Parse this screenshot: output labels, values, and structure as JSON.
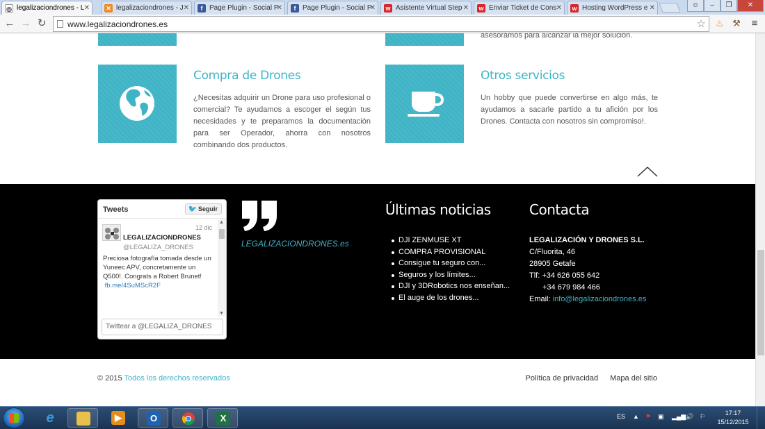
{
  "browser": {
    "tabs": [
      {
        "label": "legalizaciondrones - L",
        "favicon": "chrome-page-icon",
        "active": true
      },
      {
        "label": "legalizaciondrones - J",
        "favicon": "joomla-icon",
        "active": false
      },
      {
        "label": "Page Plugin - Social P",
        "favicon": "facebook-icon",
        "active": false
      },
      {
        "label": "Page Plugin - Social P",
        "favicon": "facebook-icon",
        "active": false
      },
      {
        "label": "Asistente Virtual Step",
        "favicon": "webempresa-icon",
        "active": false
      },
      {
        "label": "Enviar Ticket de Cons",
        "favicon": "webempresa-icon",
        "active": false
      },
      {
        "label": "Hosting WordPress e",
        "favicon": "webempresa-icon",
        "active": false
      }
    ],
    "url": "www.legalizaciondrones.es"
  },
  "services": {
    "top_partial_text": "asesoramos para alcanzar la mejor solución.",
    "items": [
      {
        "icon": "globe-icon",
        "title": "Compra de Drones",
        "text": "¿Necesitas adquirir un Drone para uso profesional o comercial? Te ayudamos a escoger el según tus necesidades y te preparamos la documentación para ser Operador, ahorra con nosotros combinando dos productos."
      },
      {
        "icon": "coffee-cup-icon",
        "title": "Otros servicios",
        "text": "Un hobby que puede convertirse en algo más, te ayudamos a sacarle partido a tu afición por los Drones. Contacta con nosotros sin compromiso!."
      }
    ]
  },
  "twitter": {
    "title": "Tweets",
    "follow_label": "Seguir",
    "tweet": {
      "date": "12 dic",
      "name": "LEGALIZACIONDRONES",
      "handle": "@LEGALIZA_DRONES",
      "text": "Preciosa fotografía tomada desde un Yuneec APV, concretamente un Q500!. Congrats a Robert Brunet!",
      "link": "fb.me/4SuMScR2F"
    },
    "compose_placeholder": "Twittear a @LEGALIZA_DRONES"
  },
  "footer": {
    "quote_site": "LEGALIZACIONDRONES.es",
    "news_heading": "Últimas noticias",
    "news": [
      "DJI ZENMUSE XT",
      "COMPRA PROVISIONAL",
      "Consigue tu seguro con...",
      "Seguros y los límites...",
      "DJI y 3DRobotics nos enseñan...",
      "El auge de los drones..."
    ],
    "contact_heading": "Contacta",
    "contact": {
      "company": "LEGALIZACIÓN Y DRONES S.L.",
      "address1": "C/Fluorita, 46",
      "address2": "28905 Getafe",
      "phone1": "Tlf: +34 626 055 642",
      "phone2": "+34 679 984 466",
      "email_label": "Email:",
      "email": "info@legalizaciondrones.es"
    }
  },
  "bottom": {
    "copyright_prefix": "© 2015",
    "copyright_link": "Todos los derechos reservados",
    "privacy": "Política de privacidad",
    "sitemap": "Mapa del sitio"
  },
  "taskbar": {
    "language": "ES",
    "time": "17:17",
    "date": "15/12/2015"
  },
  "colors": {
    "accent": "#3fb4c6",
    "footer_bg": "#000000"
  }
}
